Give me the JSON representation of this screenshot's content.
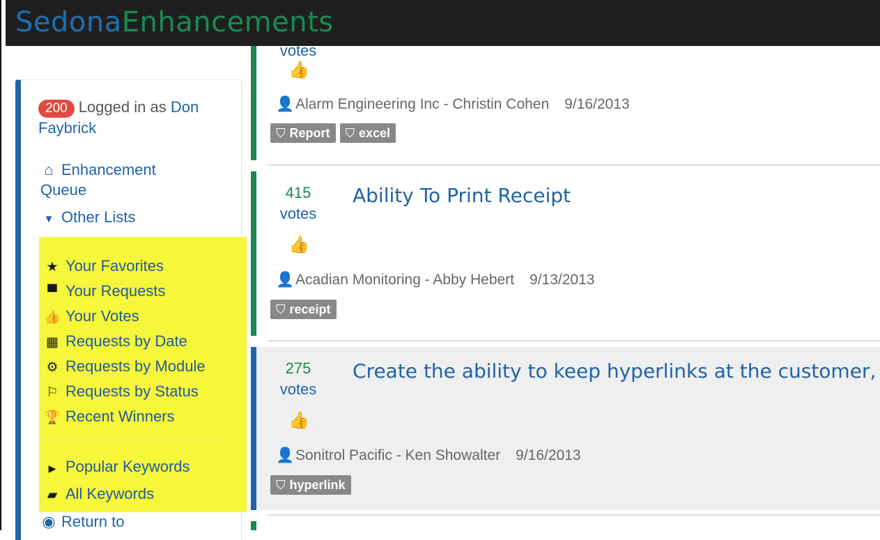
{
  "brand": {
    "part1": "Sedona",
    "part2": "Enhancements"
  },
  "sidebar": {
    "badge": "200",
    "logged_in_text": "Logged in as",
    "user_first": "Don",
    "user_last": "Faybrick",
    "nav": [
      {
        "icon": "home-icon",
        "label_line1": "Enhancement",
        "label_line2": "Queue"
      },
      {
        "icon": "caret-down-icon",
        "label": "Other Lists"
      }
    ],
    "other_lists": [
      {
        "icon": "star-icon",
        "label": "Your Favorites"
      },
      {
        "icon": "archive-icon",
        "label": "Your Requests"
      },
      {
        "icon": "thumbs-up-icon",
        "label": "Your Votes"
      },
      {
        "icon": "calendar-icon",
        "label": "Requests by Date"
      },
      {
        "icon": "gear-icon",
        "label": "Requests by Module"
      },
      {
        "icon": "flag-icon",
        "label": "Requests by Status"
      },
      {
        "icon": "trophy-icon",
        "label": "Recent Winners"
      }
    ],
    "keywords": [
      {
        "icon": "caret-right-icon",
        "label": "Popular Keywords"
      },
      {
        "icon": "book-icon",
        "label": "All Keywords"
      }
    ],
    "return": {
      "icon": "globe-icon",
      "label": "Return to"
    },
    "highlight_color": "#f6f63a"
  },
  "requests": [
    {
      "votes": "",
      "votes_label": "votes",
      "title": "",
      "company": "Alarm Engineering Inc - Christin Cohen",
      "date": "9/16/2013",
      "tags": [
        "Report",
        "excel"
      ],
      "accent": "#1a8a52"
    },
    {
      "votes": "415",
      "votes_label": "votes",
      "title": "Ability To Print Receipt",
      "company": "Acadian Monitoring - Abby Hebert",
      "date": "9/13/2013",
      "tags": [
        "receipt"
      ],
      "accent": "#1a8a52"
    },
    {
      "votes": "275",
      "votes_label": "votes",
      "title": "Create the ability to keep hyperlinks at the customer, si",
      "company": "Sonitrol Pacific - Ken Showalter",
      "date": "9/16/2013",
      "tags": [
        "hyperlink"
      ],
      "accent": "#1f63a8"
    }
  ]
}
